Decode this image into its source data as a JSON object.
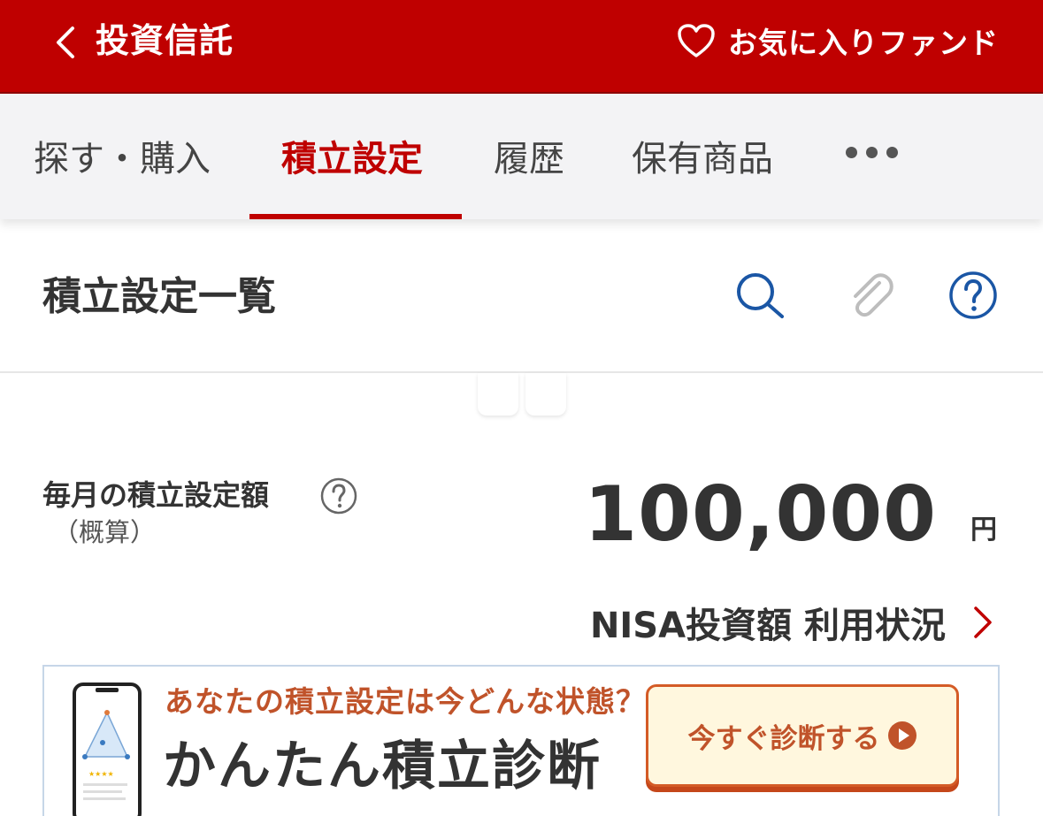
{
  "header": {
    "title": "投資信託",
    "favorites_label": "お気に入りファンド"
  },
  "tabs": [
    {
      "label": "探す・購入"
    },
    {
      "label": "積立設定"
    },
    {
      "label": "履歴"
    },
    {
      "label": "保有商品"
    }
  ],
  "active_tab": "積立設定",
  "section": {
    "title": "積立設定一覧"
  },
  "summary": {
    "label": "毎月の積立設定額",
    "sublabel": "（概算）",
    "amount": "100,000",
    "unit": "円"
  },
  "nisa_link": {
    "label": "NISA投資額 利用状況"
  },
  "banner": {
    "question": "あなたの積立設定は今どんな状態？",
    "title": "かんたん積立診断",
    "button_label": "今すぐ診断する"
  },
  "colors": {
    "brand_red": "#bf0000",
    "link_blue": "#1a56a5",
    "banner_orange": "#c0532a",
    "banner_button_bg": "#fff7de"
  }
}
